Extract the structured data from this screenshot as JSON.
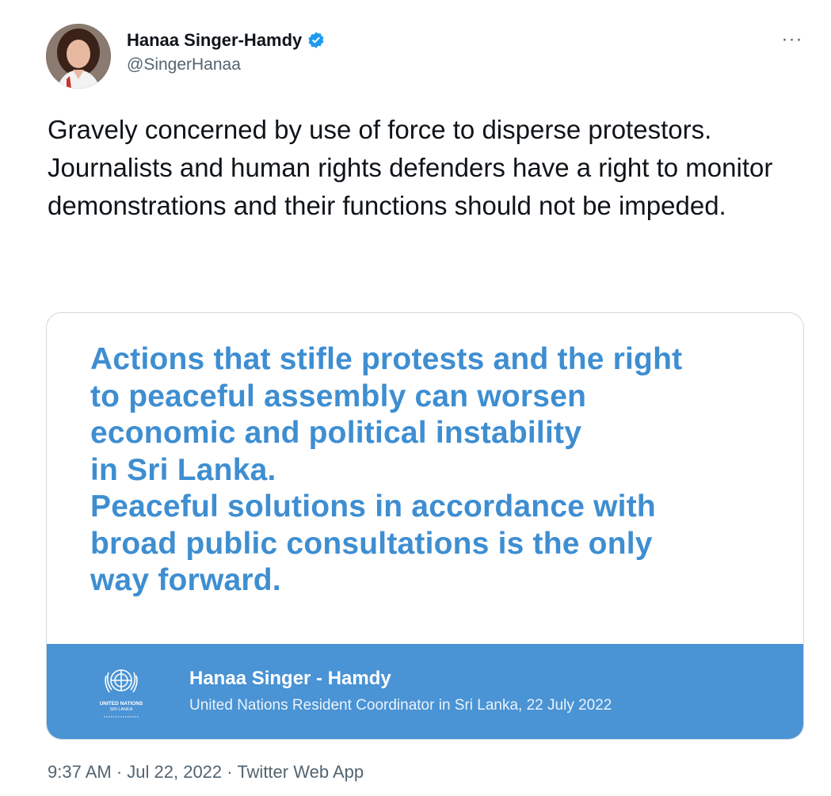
{
  "author": {
    "display_name": "Hanaa Singer-Hamdy",
    "handle": "@SingerHanaa",
    "verified": true
  },
  "menu": {
    "more_label": "···"
  },
  "tweet": {
    "paragraphs": [
      "Gravely concerned by use of force to disperse protestors.",
      "Journalists and human rights defenders have a right to monitor demonstrations and their functions should not be impeded."
    ]
  },
  "card": {
    "quote_lines": [
      "Actions that stifle protests and the right",
      "to peaceful assembly can worsen",
      "economic and political instability",
      "in Sri Lanka.",
      "Peaceful solutions in accordance with",
      "broad public consultations is the only",
      "way forward."
    ],
    "footer_name": "Hanaa Singer - Hamdy",
    "footer_subtitle": "United Nations Resident Coordinator in Sri Lanka, 22 July 2022",
    "logo_text_line1": "UNITED NATIONS",
    "logo_text_line2": "SRI LANKA"
  },
  "meta": {
    "time": "9:37 AM",
    "separator": " · ",
    "date": "Jul 22, 2022",
    "source": "Twitter Web App"
  },
  "colors": {
    "verified_badge": "#1d9bf0",
    "quote_text": "#3e8ed1",
    "card_footer": "#4a93d4"
  }
}
